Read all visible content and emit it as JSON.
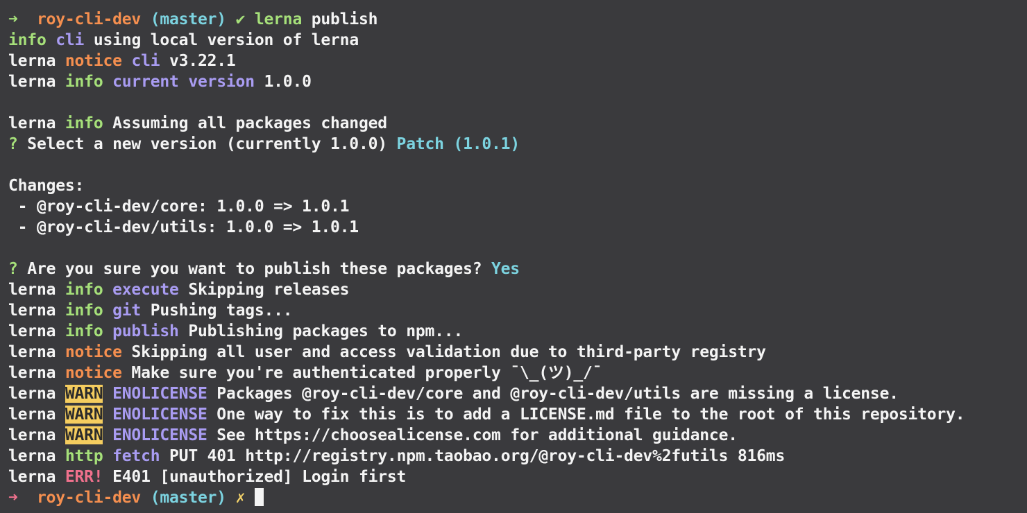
{
  "terminal": {
    "lines": [
      [
        {
          "text": "➜  ",
          "color": "green"
        },
        {
          "text": "roy-cli-dev",
          "color": "orange"
        },
        {
          "text": " (",
          "color": "cyan"
        },
        {
          "text": "master",
          "color": "cyan"
        },
        {
          "text": ") ",
          "color": "cyan"
        },
        {
          "text": "✔ ",
          "color": "green"
        },
        {
          "text": "lerna",
          "color": "green"
        },
        {
          "text": " publish",
          "color": "default"
        }
      ],
      [
        {
          "text": "info",
          "color": "green"
        },
        {
          "text": " ",
          "color": "default"
        },
        {
          "text": "cli",
          "color": "purple"
        },
        {
          "text": " using local version of lerna",
          "color": "default"
        }
      ],
      [
        {
          "text": "lerna ",
          "color": "default"
        },
        {
          "text": "notice",
          "color": "orange"
        },
        {
          "text": " ",
          "color": "default"
        },
        {
          "text": "cli",
          "color": "purple"
        },
        {
          "text": " v3.22.1",
          "color": "default"
        }
      ],
      [
        {
          "text": "lerna ",
          "color": "default"
        },
        {
          "text": "info",
          "color": "green"
        },
        {
          "text": " ",
          "color": "default"
        },
        {
          "text": "current version",
          "color": "purple"
        },
        {
          "text": " 1.0.0",
          "color": "default"
        }
      ],
      [],
      [
        {
          "text": "lerna ",
          "color": "default"
        },
        {
          "text": "info",
          "color": "green"
        },
        {
          "text": " Assuming all packages changed",
          "color": "default"
        }
      ],
      [
        {
          "text": "?",
          "color": "green"
        },
        {
          "text": " Select a new version (currently 1.0.0) ",
          "color": "default"
        },
        {
          "text": "Patch (1.0.1)",
          "color": "cyan"
        }
      ],
      [],
      [
        {
          "text": "Changes:",
          "color": "default"
        }
      ],
      [
        {
          "text": " - @roy-cli-dev/core: 1.0.0 => 1.0.1",
          "color": "default"
        }
      ],
      [
        {
          "text": " - @roy-cli-dev/utils: 1.0.0 => 1.0.1",
          "color": "default"
        }
      ],
      [],
      [
        {
          "text": "?",
          "color": "green"
        },
        {
          "text": " Are you sure you want to publish these packages? ",
          "color": "default"
        },
        {
          "text": "Yes",
          "color": "cyan"
        }
      ],
      [
        {
          "text": "lerna ",
          "color": "default"
        },
        {
          "text": "info",
          "color": "green"
        },
        {
          "text": " ",
          "color": "default"
        },
        {
          "text": "execute",
          "color": "purple"
        },
        {
          "text": " Skipping releases",
          "color": "default"
        }
      ],
      [
        {
          "text": "lerna ",
          "color": "default"
        },
        {
          "text": "info",
          "color": "green"
        },
        {
          "text": " ",
          "color": "default"
        },
        {
          "text": "git",
          "color": "purple"
        },
        {
          "text": " Pushing tags...",
          "color": "default"
        }
      ],
      [
        {
          "text": "lerna ",
          "color": "default"
        },
        {
          "text": "info",
          "color": "green"
        },
        {
          "text": " ",
          "color": "default"
        },
        {
          "text": "publish",
          "color": "purple"
        },
        {
          "text": " Publishing packages to npm...",
          "color": "default"
        }
      ],
      [
        {
          "text": "lerna ",
          "color": "default"
        },
        {
          "text": "notice",
          "color": "orange"
        },
        {
          "text": " Skipping all user and access validation due to third-party registry",
          "color": "default"
        }
      ],
      [
        {
          "text": "lerna ",
          "color": "default"
        },
        {
          "text": "notice",
          "color": "orange"
        },
        {
          "text": " Make sure you're authenticated properly ¯\\_(ツ)_/¯",
          "color": "default"
        }
      ],
      [
        {
          "text": "lerna ",
          "color": "default"
        },
        {
          "text": "WARN",
          "color": "warn"
        },
        {
          "text": " ",
          "color": "default"
        },
        {
          "text": "ENOLICENSE",
          "color": "purple"
        },
        {
          "text": " Packages @roy-cli-dev/core and @roy-cli-dev/utils are missing a license.",
          "color": "default"
        }
      ],
      [
        {
          "text": "lerna ",
          "color": "default"
        },
        {
          "text": "WARN",
          "color": "warn"
        },
        {
          "text": " ",
          "color": "default"
        },
        {
          "text": "ENOLICENSE",
          "color": "purple"
        },
        {
          "text": " One way to fix this is to add a LICENSE.md file to the root of this repository.",
          "color": "default"
        }
      ],
      [
        {
          "text": "lerna ",
          "color": "default"
        },
        {
          "text": "WARN",
          "color": "warn"
        },
        {
          "text": " ",
          "color": "default"
        },
        {
          "text": "ENOLICENSE",
          "color": "purple"
        },
        {
          "text": " See https://choosealicense.com for additional guidance.",
          "color": "default"
        }
      ],
      [
        {
          "text": "lerna ",
          "color": "default"
        },
        {
          "text": "http",
          "color": "green"
        },
        {
          "text": " ",
          "color": "default"
        },
        {
          "text": "fetch",
          "color": "purple"
        },
        {
          "text": " PUT 401 http://registry.npm.taobao.org/@roy-cli-dev%2futils 816ms",
          "color": "default"
        }
      ],
      [
        {
          "text": "lerna ",
          "color": "default"
        },
        {
          "text": "ERR!",
          "color": "pink"
        },
        {
          "text": " E401 [unauthorized] Login first",
          "color": "default"
        }
      ],
      [
        {
          "text": "➜  ",
          "color": "pink"
        },
        {
          "text": "roy-cli-dev",
          "color": "orange"
        },
        {
          "text": " (",
          "color": "cyan"
        },
        {
          "text": "master",
          "color": "cyan"
        },
        {
          "text": ") ",
          "color": "cyan"
        },
        {
          "text": "✗ ",
          "color": "yellow"
        }
      ]
    ]
  },
  "colors": {
    "background": "#3a3a3d",
    "default": "#f4f4f4",
    "green": "#a6e07a",
    "orange": "#f58f4f",
    "purple": "#a99cf2",
    "cyan": "#7cd3e0",
    "pink": "#f0718d",
    "yellow": "#f5d46a",
    "warn_bg": "#f5cd5f"
  }
}
